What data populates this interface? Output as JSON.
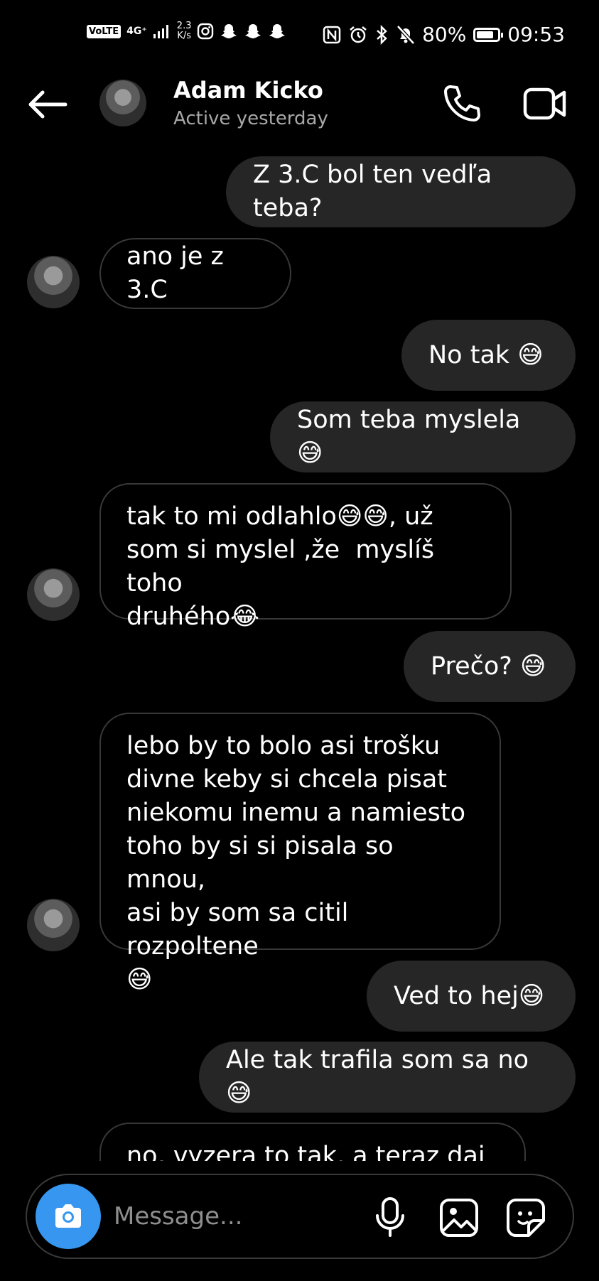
{
  "status_bar": {
    "volte": "VoLTE",
    "network": "4G⁺",
    "speed_value": "2.3",
    "speed_unit": "K/s",
    "battery_percent": "80%",
    "battery_level": 0.8,
    "time": "09:53"
  },
  "header": {
    "name": "Adam Kicko",
    "status": "Active yesterday"
  },
  "messages": [
    {
      "side": "out",
      "text": "Z 3.C bol ten vedľa teba?"
    },
    {
      "side": "in",
      "text": "ano je z 3.C"
    },
    {
      "side": "out",
      "text": "No tak 😅"
    },
    {
      "side": "out",
      "text": "Som teba myslela 😅"
    },
    {
      "side": "in",
      "text": "tak to mi odlahlo😅😅, už\nsom si myslel ,že  myslíš toho\ndruhého😂"
    },
    {
      "side": "out",
      "text": "Prečo? 😅"
    },
    {
      "side": "in",
      "text": "lebo by to bolo asi trošku\ndivne keby si chcela pisat\nniekomu inemu a namiesto\ntoho by si si pisala so mnou,\nasi by som sa citil rozpoltene\n😅"
    },
    {
      "side": "out",
      "text": "Ved to hej😅"
    },
    {
      "side": "out",
      "text": "Ale tak trafila som sa no😅"
    },
    {
      "side": "in",
      "text": "no, vyzera to tak, a teraz daj"
    }
  ],
  "composer": {
    "placeholder": "Message..."
  },
  "colors": {
    "accent": "#3797f0",
    "outgoing_bubble": "#262626",
    "incoming_border": "#383838",
    "background": "#000000"
  }
}
